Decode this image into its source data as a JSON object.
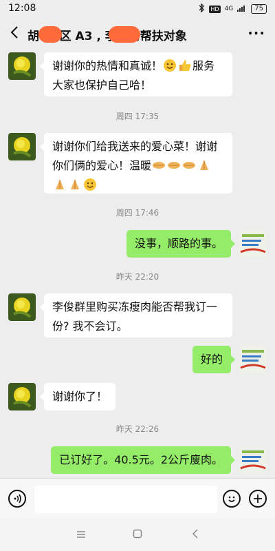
{
  "status_bar": {
    "time": "12:08",
    "network": "4G",
    "battery": "75",
    "hd": "HD"
  },
  "header": {
    "title": "胡  10区 A3    , 李俊的帮扶对象"
  },
  "messages": [
    {
      "sender": "other",
      "text_a": "谢谢你的热情和真诚！",
      "text_b": "服务大家也保护自己哈！"
    },
    {
      "time": "周四 17:35"
    },
    {
      "sender": "other",
      "text_a": "谢谢你们给我送来的爱心菜！谢谢你们俩的爱心！温暖"
    },
    {
      "time": "周四 17:46"
    },
    {
      "sender": "me",
      "text": "没事，顺路的事。"
    },
    {
      "time": "昨天 22:20"
    },
    {
      "sender": "other",
      "text": "李俊群里购买冻瘦肉能否帮我订一份? 我不会订。"
    },
    {
      "sender": "me",
      "text": "好的"
    },
    {
      "sender": "other",
      "text": "谢谢你了！"
    },
    {
      "time": "昨天 22:26"
    },
    {
      "sender": "me",
      "text": "已订好了。40.5元。2公斤廋肉。"
    }
  ],
  "input_bar": {
    "placeholder": ""
  },
  "icons": {
    "back": "back-arrow-icon",
    "more": "more-dots-icon",
    "voice": "voice-icon",
    "emoji": "emoji-icon",
    "add": "add-icon",
    "nav_menu": "menu-icon",
    "nav_home": "home-icon",
    "nav_back": "nav-back-icon"
  },
  "colors": {
    "background": "#ededed",
    "my_bubble": "#95ec69",
    "other_bubble": "#ffffff",
    "redaction": "#ff6a3a"
  }
}
